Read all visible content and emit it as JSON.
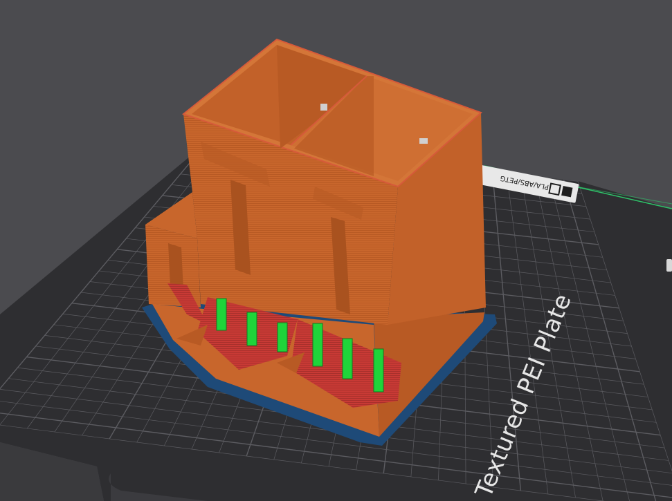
{
  "viewport": {
    "plate_label": "Textured PEI Plate",
    "plate_filament_tag": "PLA/ABS/PETG",
    "colors": {
      "background": "#4b4b4f",
      "bed": "#2e2e31",
      "bed_edge": "#3f3f43",
      "grid": "#5c5c61",
      "brim": "#1e4a78",
      "wall": "#c8662c",
      "wall_dark": "#a9521f",
      "overhang": "#c83a35",
      "support": "#1fd43a",
      "axis_green": "#2ec46a",
      "axis_red": "#d23b3b"
    },
    "tag_icons": [
      "filament-plate-icon",
      "grid-icon"
    ]
  }
}
